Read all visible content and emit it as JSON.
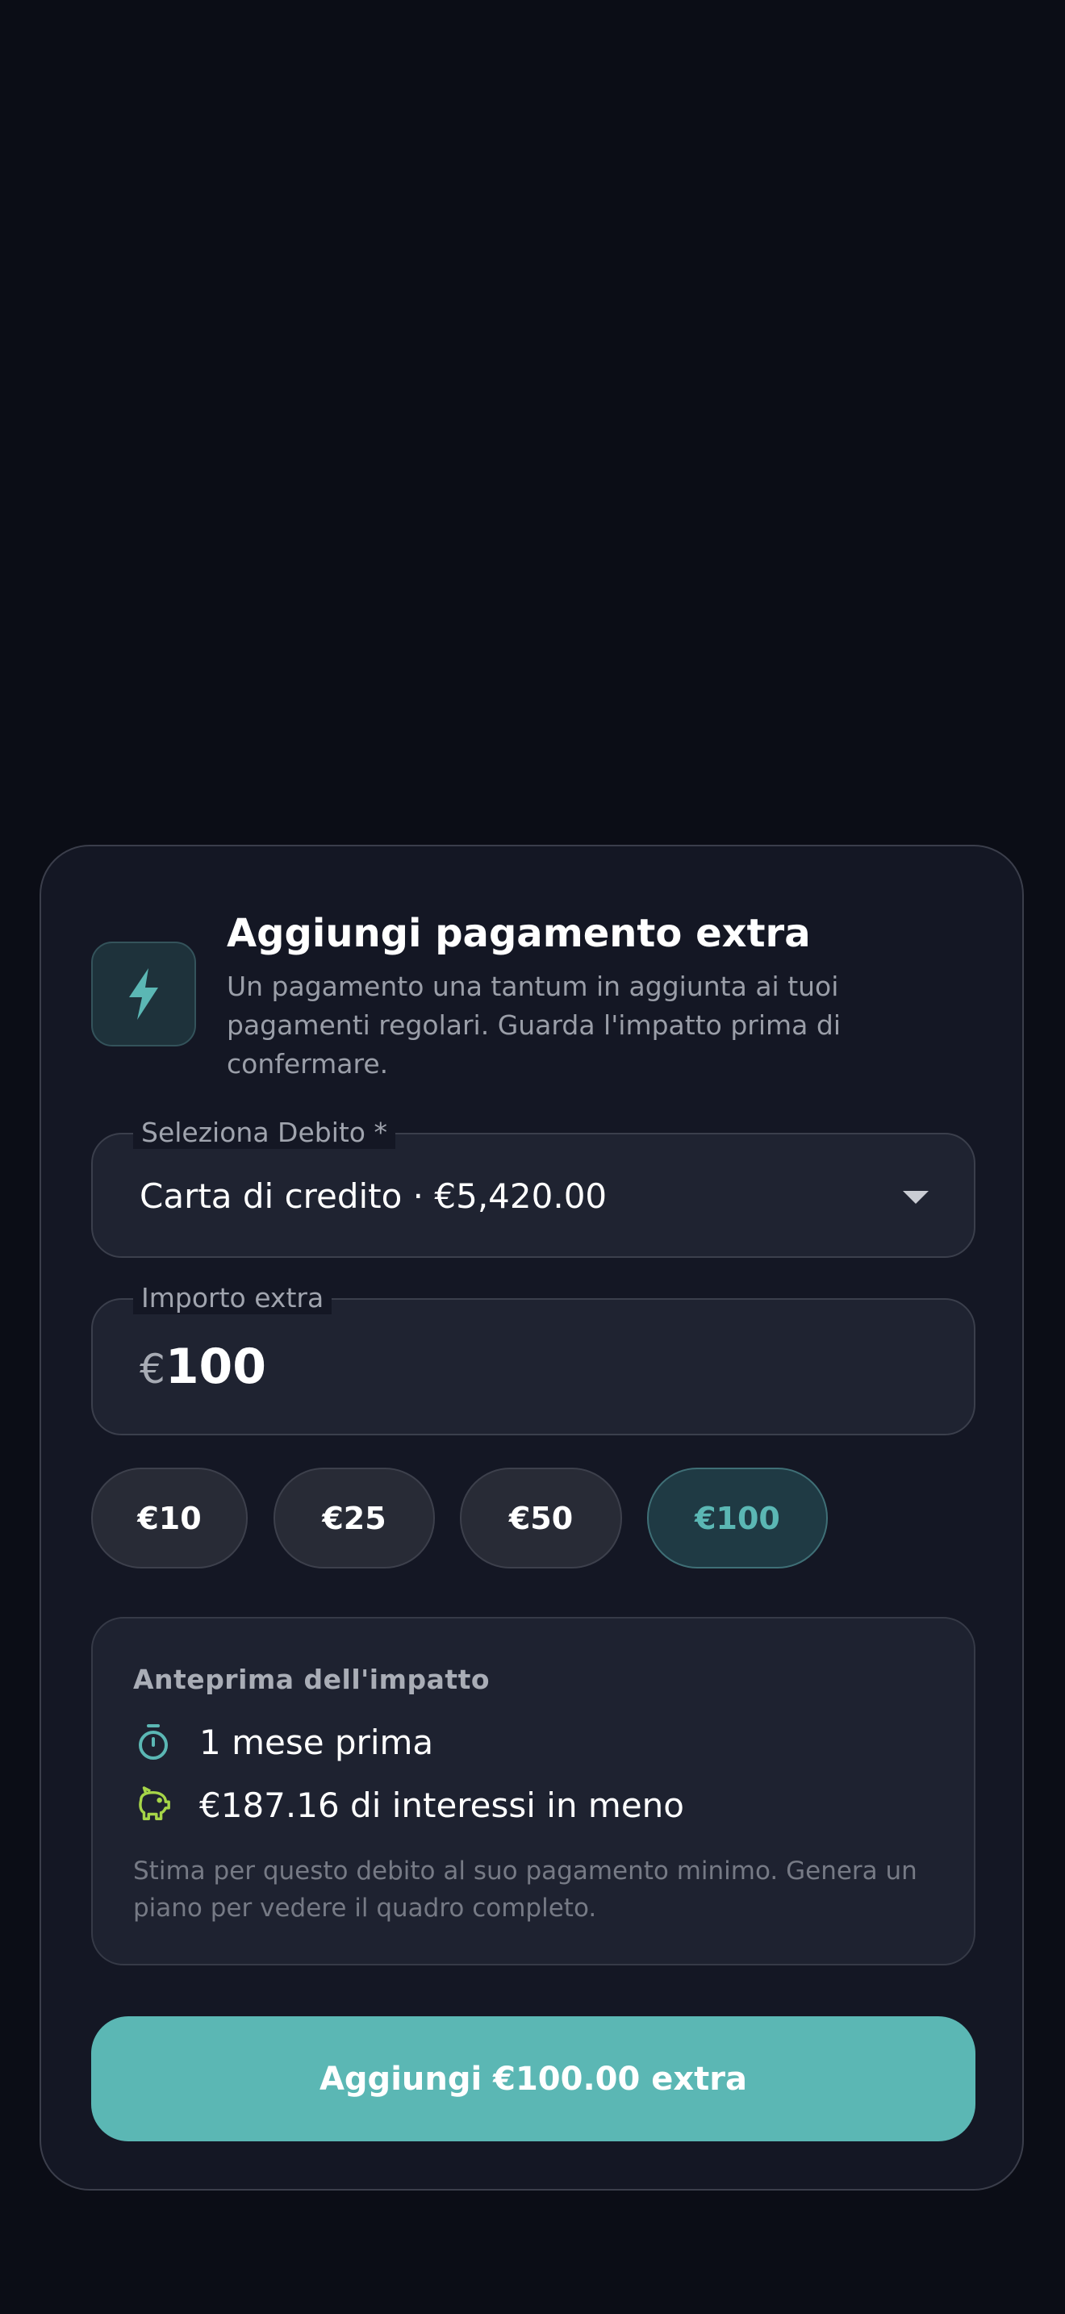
{
  "colors": {
    "background": "#0b0d16",
    "sheet": "#141724",
    "accent": "#5bb7b4",
    "piggy_icon": "#a6d548"
  },
  "dialog": {
    "icon": "lightning-bolt-icon",
    "title": "Aggiungi pagamento extra",
    "subtitle": "Un pagamento una tantum in aggiunta ai tuoi pagamenti regolari. Guarda l'impatto prima di confermare."
  },
  "debt_select": {
    "label": "Seleziona Debito *",
    "value": "Carta di credito · €5,420.00"
  },
  "amount_field": {
    "label": "Importo extra",
    "currency": "€",
    "value": "100"
  },
  "quick_amounts": [
    {
      "label": "€10",
      "selected": false
    },
    {
      "label": "€25",
      "selected": false
    },
    {
      "label": "€50",
      "selected": false
    },
    {
      "label": "€100",
      "selected": true
    }
  ],
  "impact": {
    "title": "Anteprima dell'impatto",
    "rows": [
      {
        "icon": "stopwatch-icon",
        "text": "1 mese prima"
      },
      {
        "icon": "piggy-bank-icon",
        "text": "€187.16 di interessi in meno"
      }
    ],
    "note": "Stima per questo debito al suo pagamento minimo. Genera un piano per vedere il quadro completo."
  },
  "submit": {
    "label": "Aggiungi €100.00 extra"
  }
}
